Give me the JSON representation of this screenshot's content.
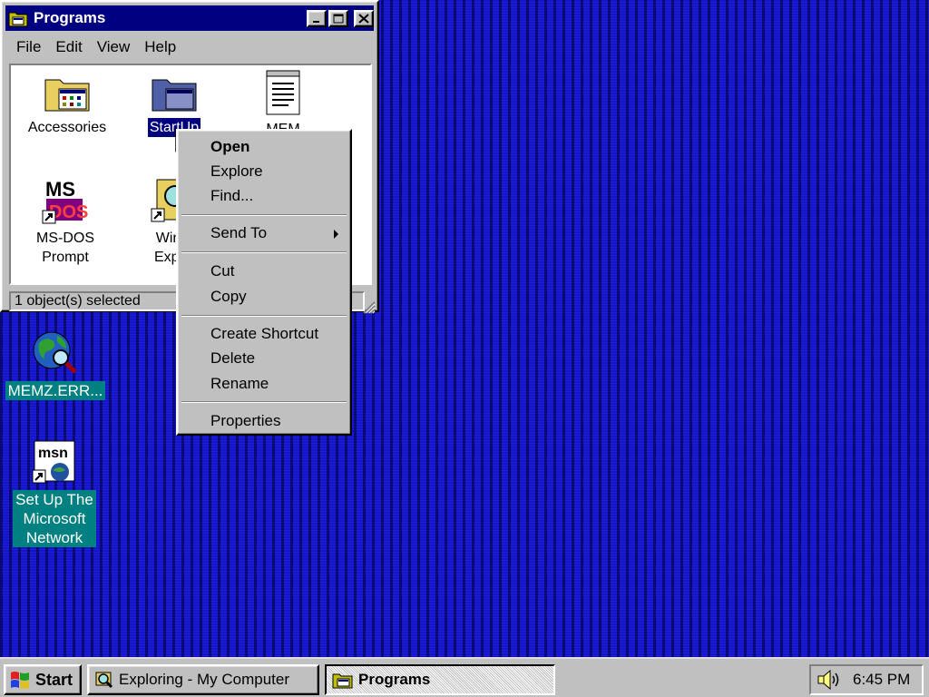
{
  "window": {
    "title": "Programs",
    "menu": [
      "File",
      "Edit",
      "View",
      "Help"
    ],
    "items": [
      {
        "label": "Accessories",
        "icon": "folder-icon"
      },
      {
        "label": "StartUp",
        "icon": "folder-icon",
        "selected": true
      },
      {
        "label": "MEM",
        "icon": "notepad-document-icon"
      },
      {
        "label_line1": "MS-DOS",
        "label_line2": "Prompt",
        "icon": "ms-dos-icon"
      },
      {
        "label_line1": "Wind",
        "label_line2": "Explo",
        "icon": "windows-explorer-icon"
      }
    ],
    "status": "1 object(s) selected"
  },
  "context_menu": {
    "items": [
      "Open",
      "Explore",
      "Find...",
      "Send To",
      "Cut",
      "Copy",
      "Create Shortcut",
      "Delete",
      "Rename",
      "Properties"
    ]
  },
  "desktop": {
    "icons": [
      {
        "label": "MEMZ.ERR...",
        "icon": "globe-magnifier-icon"
      },
      {
        "label_lines": [
          "Set Up The",
          "Microsoft",
          "Network"
        ],
        "icon": "msn-icon"
      }
    ]
  },
  "taskbar": {
    "start_label": "Start",
    "tasks": [
      "Exploring - My Computer",
      "Programs"
    ],
    "clock": "6:45 PM"
  },
  "colors": {
    "desktop": "#1414c8",
    "titlebar": "#000080",
    "face": "#c0c0c0",
    "icon_label_bg": "#008080"
  }
}
